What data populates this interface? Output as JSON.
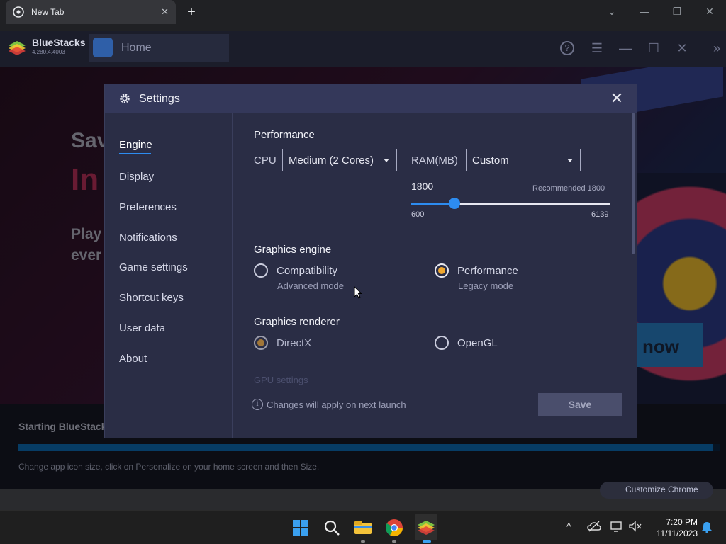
{
  "chrome": {
    "tab_title": "New Tab",
    "tab_close": "✕",
    "new_tab": "+",
    "win_chevron": "⌄",
    "win_min": "—",
    "win_restore": "❐",
    "win_close": "✕"
  },
  "bluestacks": {
    "name": "BlueStacks",
    "version": "4.280.4.4003",
    "home_tab": "Home",
    "help": "?",
    "menu": "☰",
    "minimize": "—",
    "maximize": "☐",
    "close": "✕",
    "expand": "»"
  },
  "background": {
    "headline_partial": "Sav",
    "headline_red": "In",
    "subline_1": "Play",
    "subline_2": "ever",
    "cta": "now",
    "customize_chrome": "Customize Chrome"
  },
  "status": {
    "title": "Starting BlueStacks",
    "tip": "Change app icon size, click on Personalize on your home screen and then Size.",
    "progress": 0.99
  },
  "dialog": {
    "title": "Settings",
    "close": "✕",
    "sidebar": [
      {
        "label": "Engine"
      },
      {
        "label": "Display"
      },
      {
        "label": "Preferences"
      },
      {
        "label": "Notifications"
      },
      {
        "label": "Game settings"
      },
      {
        "label": "Shortcut keys"
      },
      {
        "label": "User data"
      },
      {
        "label": "About"
      }
    ],
    "performance": {
      "title": "Performance",
      "cpu_label": "CPU",
      "cpu_value": "Medium (2 Cores)",
      "ram_label": "RAM(MB)",
      "ram_value": "Custom",
      "ram_amount": "1800",
      "ram_recommended": "Recommended 1800",
      "ram_min": "600",
      "ram_max": "6139",
      "ram_current": 1800
    },
    "graphics_engine": {
      "title": "Graphics engine",
      "options": [
        {
          "label": "Compatibility",
          "sub": "Advanced mode",
          "checked": false
        },
        {
          "label": "Performance",
          "sub": "Legacy mode",
          "checked": true
        }
      ]
    },
    "graphics_renderer": {
      "title": "Graphics renderer",
      "options": [
        {
          "label": "DirectX",
          "checked": true
        },
        {
          "label": "OpenGL",
          "checked": false
        }
      ]
    },
    "gpu_settings_faded": "GPU settings",
    "info_icon": "i",
    "footer_note": "Changes will apply on next launch",
    "save": "Save"
  },
  "taskbar": {
    "time": "7:20 PM",
    "date": "11/11/2023",
    "tray_chevron": "^"
  },
  "colors": {
    "accent_blue": "#2d8cf0",
    "radio_orange": "#f0a830",
    "dialog_bg": "#2a2d45"
  }
}
